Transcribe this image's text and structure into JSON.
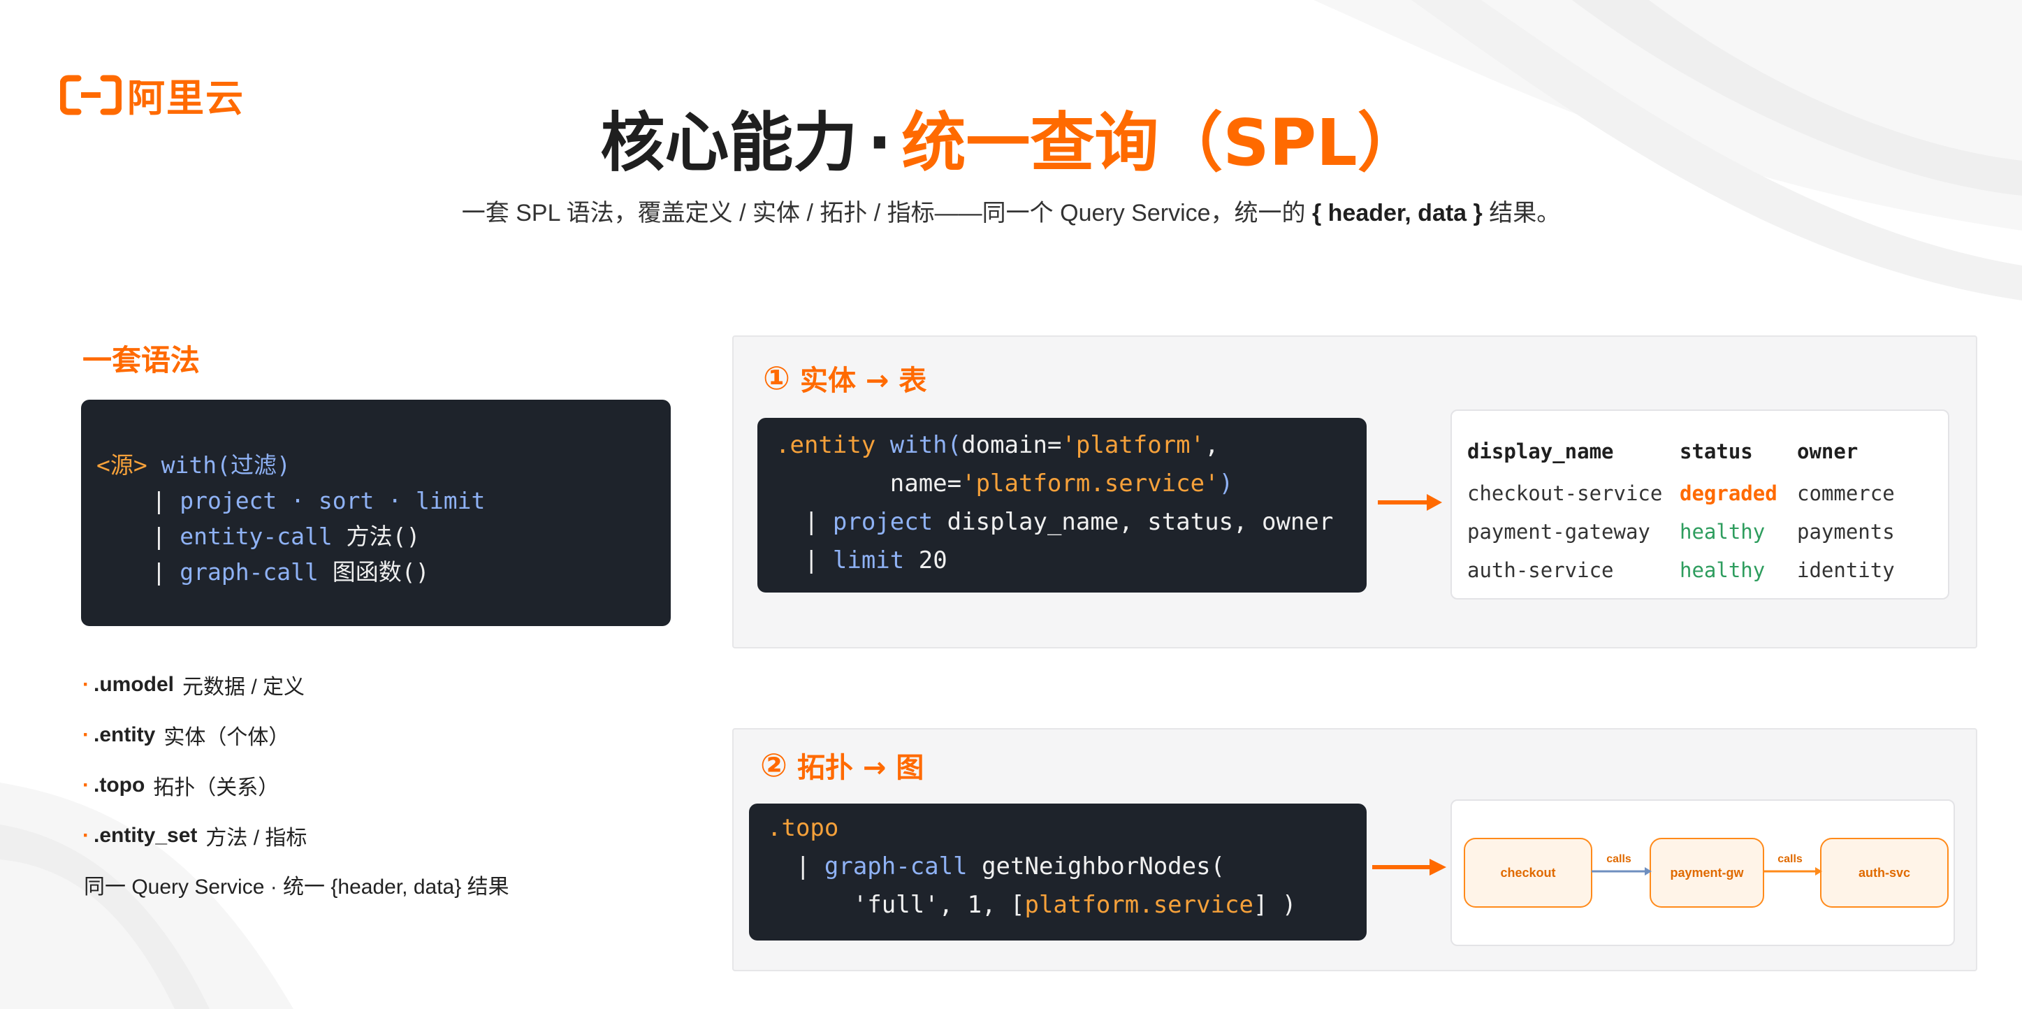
{
  "brand": {
    "name": "阿里云",
    "color": "#ff6a00"
  },
  "title": {
    "main": "核心能力",
    "dot": "·",
    "accent": "统一查询（SPL）"
  },
  "subtitle": {
    "prefix": "一套 SPL 语法，覆盖定义 / 实体 / 拓扑 / 指标——同一个 Query Service，统一的",
    "bold": "{ header, data }",
    "suffix": "结果。"
  },
  "left": {
    "heading": "一套语法",
    "code": {
      "l1_src": "<源>",
      "l1_with": "with(过滤)",
      "l2_pipe": "    | ",
      "l2": "project · sort · limit",
      "l3_pipe": "    | ",
      "l3_kw": "entity-call",
      "l3_rest": " 方法()",
      "l4_pipe": "    | ",
      "l4_kw": "graph-call",
      "l4_rest": " 图函数()"
    },
    "bullets": [
      {
        "dot": "·",
        "key": ".umodel",
        "desc": "元数据 / 定义"
      },
      {
        "dot": "·",
        "key": ".entity",
        "desc": "实体（个体）"
      },
      {
        "dot": "·",
        "key": ".topo",
        "desc": "拓扑（关系）"
      },
      {
        "dot": "·",
        "key": ".entity_set",
        "desc": "方法 / 指标"
      }
    ],
    "note": "同一 Query Service · 统一 {header, data} 结果"
  },
  "panel1": {
    "num": "①",
    "heading": "实体 → 表",
    "code": {
      "l1_a": ".entity ",
      "l1_b": "with(",
      "l1_c": "domain=",
      "l1_d": "'platform'",
      "l1_e": ",",
      "l2_a": "        name=",
      "l2_b": "'platform.service'",
      "l2_c": ")",
      "l3_pipe": "  | ",
      "l3_kw": "project",
      "l3_rest": " display_name, status, owner",
      "l4_pipe": "  | ",
      "l4_kw": "limit",
      "l4_rest": " 20"
    },
    "table": {
      "headers": [
        "display_name",
        "status",
        "owner"
      ],
      "rows": [
        {
          "name": "checkout-service",
          "status": "degraded",
          "owner": "commerce"
        },
        {
          "name": "payment-gateway",
          "status": "healthy",
          "owner": "payments"
        },
        {
          "name": "auth-service",
          "status": "healthy",
          "owner": "identity"
        }
      ]
    }
  },
  "panel2": {
    "num": "②",
    "heading": "拓扑 → 图",
    "code": {
      "l1": ".topo",
      "l2_pipe": "  | ",
      "l2_kw": "graph-call",
      "l2_rest": " getNeighborNodes(",
      "l3_a": "      'full', 1, [",
      "l3_b": "platform.service",
      "l3_c": "] )"
    },
    "graph": {
      "nodes": [
        "checkout",
        "payment-gw",
        "auth-svc"
      ],
      "edges": [
        "calls",
        "calls"
      ]
    }
  }
}
